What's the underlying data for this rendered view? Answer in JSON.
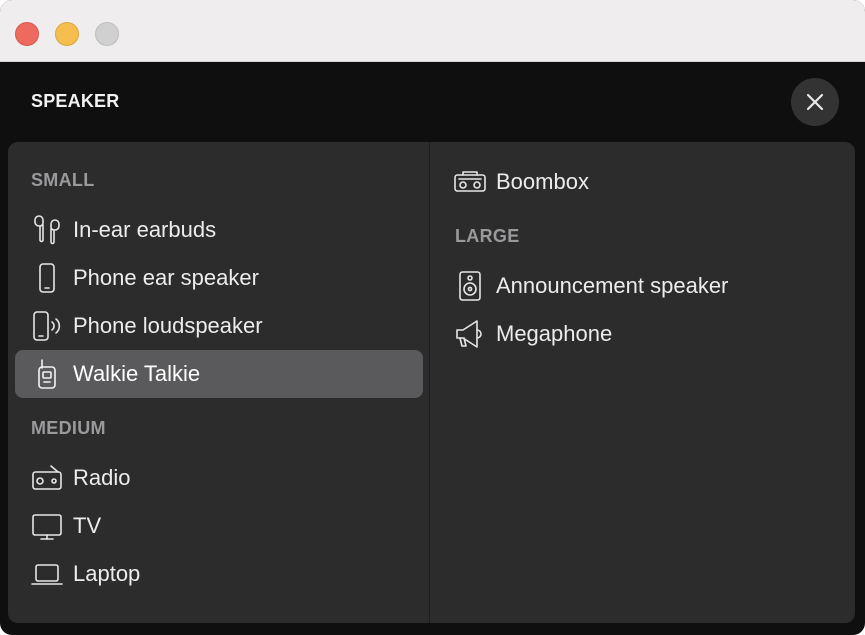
{
  "window": {
    "title_controls": [
      "close",
      "minimize",
      "maximize"
    ]
  },
  "header": {
    "title": "SPEAKER",
    "close_icon": "xmark-icon"
  },
  "left_column": {
    "sections": [
      {
        "title": "SMALL",
        "items": [
          {
            "label": "In-ear earbuds",
            "icon": "earbuds-icon",
            "selected": false
          },
          {
            "label": "Phone ear speaker",
            "icon": "phone-icon",
            "selected": false
          },
          {
            "label": "Phone loudspeaker",
            "icon": "phone-loudspeaker-icon",
            "selected": false
          },
          {
            "label": "Walkie Talkie",
            "icon": "walkie-talkie-icon",
            "selected": true
          }
        ]
      },
      {
        "title": "MEDIUM",
        "items": [
          {
            "label": "Radio",
            "icon": "radio-icon",
            "selected": false
          },
          {
            "label": "TV",
            "icon": "tv-icon",
            "selected": false
          },
          {
            "label": "Laptop",
            "icon": "laptop-icon",
            "selected": false
          }
        ]
      }
    ]
  },
  "right_column": {
    "items_top": [
      {
        "label": "Boombox",
        "icon": "boombox-icon",
        "selected": false
      }
    ],
    "sections": [
      {
        "title": "LARGE",
        "items": [
          {
            "label": "Announcement speaker",
            "icon": "hifi-speaker-icon",
            "selected": false
          },
          {
            "label": "Megaphone",
            "icon": "megaphone-icon",
            "selected": false
          }
        ]
      }
    ]
  },
  "colors": {
    "background": "#0f0f10",
    "panel": "#2c2c2d",
    "selected": "#5a5a5c",
    "section_text": "#9a9a9c",
    "item_text": "#ececec"
  }
}
